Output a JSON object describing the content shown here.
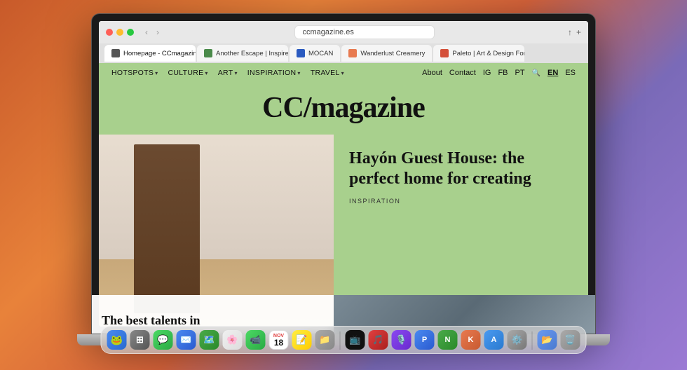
{
  "browser": {
    "url": "ccmagazine.es",
    "tabs": [
      {
        "id": "tab-homepage",
        "label": "Homepage - CCmagazine",
        "active": true,
        "color": "#fff"
      },
      {
        "id": "tab-another-escape",
        "label": "Another Escape | Inspired by nature",
        "active": false,
        "color": "#4a8a4a"
      },
      {
        "id": "tab-mocan",
        "label": "MOCAN",
        "active": false,
        "color": "#2a5ac0"
      },
      {
        "id": "tab-wanderlust",
        "label": "Wanderlust Creamery",
        "active": false,
        "color": "#e87a50"
      },
      {
        "id": "tab-paleto",
        "label": "Paleto | Art & Design For Your Every Day",
        "active": false,
        "color": "#d4503a"
      }
    ],
    "toolbar": {
      "back": "‹",
      "forward": "›",
      "share": "↑",
      "new_tab": "+",
      "sidebar": "⊞"
    }
  },
  "website": {
    "title": "CC/magazine",
    "nav": {
      "left": [
        {
          "label": "HOTSPOTS",
          "has_dropdown": true
        },
        {
          "label": "CULTURE",
          "has_dropdown": true
        },
        {
          "label": "ART",
          "has_dropdown": true
        },
        {
          "label": "INSPIRATION",
          "has_dropdown": true
        },
        {
          "label": "TRAVEL",
          "has_dropdown": true
        }
      ],
      "right": [
        {
          "label": "About"
        },
        {
          "label": "Contact"
        },
        {
          "label": "IG"
        },
        {
          "label": "FB"
        },
        {
          "label": "PT"
        },
        {
          "label": "🔍",
          "is_icon": true
        },
        {
          "label": "EN",
          "active": true
        },
        {
          "label": "ES"
        }
      ]
    },
    "feature": {
      "headline": "Hayón Guest House: the perfect home for creating",
      "category": "INSPIRATION"
    },
    "bottom_article": {
      "headline": "The best talents in"
    }
  },
  "dock": {
    "icons": [
      {
        "id": "finder",
        "emoji": "🐸",
        "color": "#4a9af0"
      },
      {
        "id": "launchpad",
        "emoji": "⊞",
        "color": "#888"
      },
      {
        "id": "messages",
        "emoji": "💬",
        "color": "#4cd964"
      },
      {
        "id": "mail",
        "emoji": "✉️",
        "color": "#4a8af0"
      },
      {
        "id": "maps",
        "emoji": "🗺️",
        "color": "#4a9a4a"
      },
      {
        "id": "photos",
        "emoji": "🌸",
        "color": "#e87a50"
      },
      {
        "id": "facetime",
        "emoji": "📹",
        "color": "#4cd964"
      },
      {
        "id": "calendar",
        "emoji": "📅",
        "color": "#e04040"
      },
      {
        "id": "notes",
        "emoji": "📝",
        "color": "#ffcc00"
      },
      {
        "id": "files",
        "emoji": "📁",
        "color": "#4a8af0"
      },
      {
        "id": "appletv",
        "emoji": "📺",
        "color": "#111"
      },
      {
        "id": "music",
        "emoji": "🎵",
        "color": "#e04040"
      },
      {
        "id": "podcasts",
        "emoji": "🎙️",
        "color": "#8a4af0"
      },
      {
        "id": "pages",
        "emoji": "📄",
        "color": "#4a8af0"
      },
      {
        "id": "numbers",
        "emoji": "📊",
        "color": "#4a9a4a"
      },
      {
        "id": "keynote",
        "emoji": "📊",
        "color": "#e87a50"
      },
      {
        "id": "systemprefs",
        "emoji": "⚙️",
        "color": "#888"
      },
      {
        "id": "finder2",
        "emoji": "📂",
        "color": "#4a8af0"
      },
      {
        "id": "trash",
        "emoji": "🗑️",
        "color": "#888"
      }
    ]
  }
}
